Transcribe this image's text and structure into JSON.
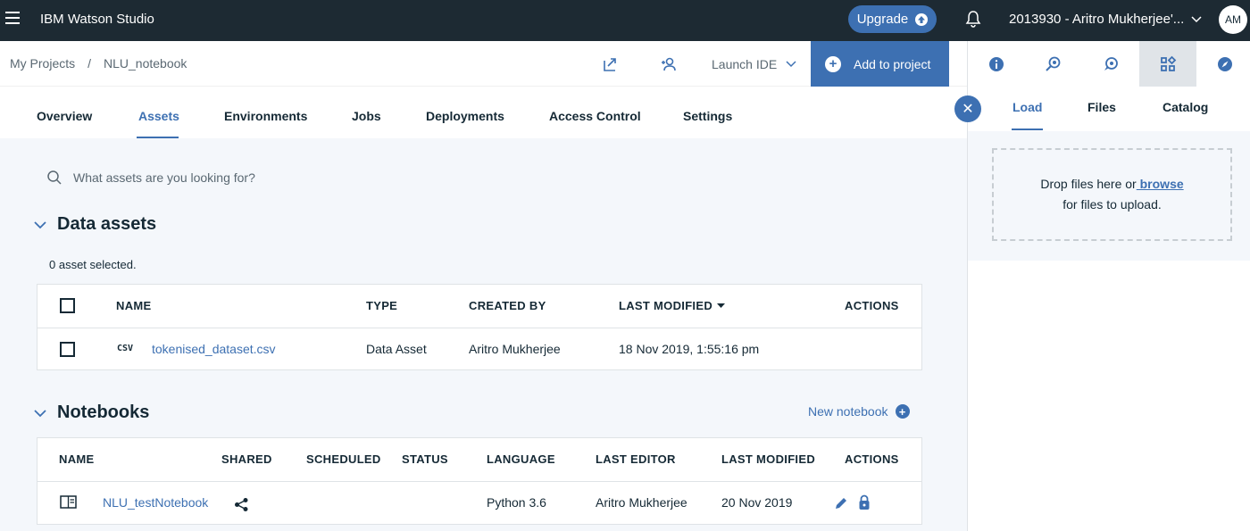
{
  "topbar": {
    "app_title": "IBM Watson Studio",
    "upgrade_label": "Upgrade",
    "account_label": "2013930 - Aritro Mukherjee'...",
    "avatar_initials": "AM"
  },
  "header": {
    "breadcrumb": [
      "My Projects",
      "NLU_notebook"
    ],
    "breadcrumb_sep": "/",
    "launch_ide": "Launch IDE",
    "add_to_project": "Add to project"
  },
  "tabs": [
    "Overview",
    "Assets",
    "Environments",
    "Jobs",
    "Deployments",
    "Access Control",
    "Settings"
  ],
  "active_tab": "Assets",
  "search": {
    "placeholder": "What assets are you looking for?"
  },
  "data_assets": {
    "title": "Data assets",
    "selected_count": "0 asset selected.",
    "columns": [
      "NAME",
      "TYPE",
      "CREATED BY",
      "LAST MODIFIED",
      "ACTIONS"
    ],
    "rows": [
      {
        "file_tag": "CSV",
        "name": "tokenised_dataset.csv",
        "type": "Data Asset",
        "created_by": "Aritro Mukherjee",
        "last_modified": "18 Nov 2019, 1:55:16 pm"
      }
    ]
  },
  "notebooks": {
    "title": "Notebooks",
    "new_notebook": "New notebook",
    "columns": [
      "NAME",
      "SHARED",
      "SCHEDULED",
      "STATUS",
      "LANGUAGE",
      "LAST EDITOR",
      "LAST MODIFIED",
      "ACTIONS"
    ],
    "rows": [
      {
        "name": "NLU_testNotebook",
        "language": "Python 3.6",
        "last_editor": "Aritro Mukherjee",
        "last_modified": "20 Nov 2019"
      }
    ]
  },
  "right_panel": {
    "tabs": [
      "Load",
      "Files",
      "Catalog"
    ],
    "active_tab": "Load",
    "drop_text_1": "Drop files here or",
    "browse": " browse",
    "drop_text_2": "for files to upload."
  },
  "colors": {
    "topbar": "#1d2a33",
    "accent": "#3d70b2",
    "background": "#f4f7fb"
  }
}
